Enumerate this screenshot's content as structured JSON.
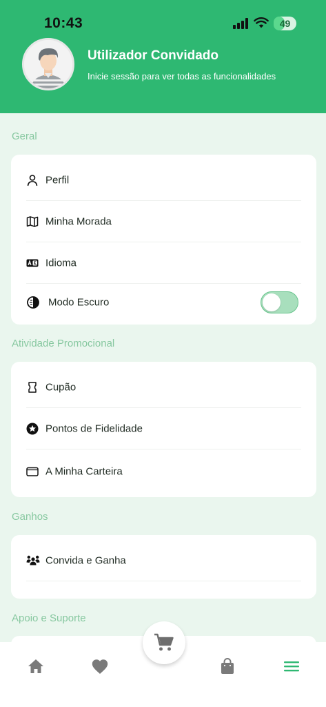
{
  "status_bar": {
    "time": "10:43",
    "battery": "49",
    "battery_level_percent": 49
  },
  "profile": {
    "name": "Utilizador Convidado",
    "subtitle": "Inicie sessão para ver todas as funcionalidades",
    "avatar_icon": "user-avatar-icon"
  },
  "sections": {
    "general": {
      "title": "Geral",
      "items": [
        {
          "label": "Perfil",
          "icon": "person-icon"
        },
        {
          "label": "Minha Morada",
          "icon": "map-icon"
        },
        {
          "label": "Idioma",
          "icon": "language-icon"
        },
        {
          "label": "Modo Escuro",
          "icon": "contrast-icon",
          "toggle": false
        }
      ]
    },
    "promo": {
      "title": "Atividade Promocional",
      "items": [
        {
          "label": "Cupão",
          "icon": "coupon-icon"
        },
        {
          "label": "Pontos de Fidelidade",
          "icon": "star-badge-icon"
        },
        {
          "label": "A Minha Carteira",
          "icon": "wallet-icon"
        }
      ]
    },
    "earnings": {
      "title": "Ganhos",
      "items": [
        {
          "label": "Convida e Ganha",
          "icon": "group-icon"
        }
      ]
    },
    "support": {
      "title": "Apoio e Suporte"
    }
  },
  "bottom_nav": {
    "items": [
      "home-icon",
      "heart-icon",
      "cart-icon",
      "bag-icon",
      "menu-icon"
    ],
    "active": "menu-icon"
  },
  "colors": {
    "accent": "#2eb872",
    "background": "#eaf6ee",
    "section_title": "#87c8a0"
  }
}
